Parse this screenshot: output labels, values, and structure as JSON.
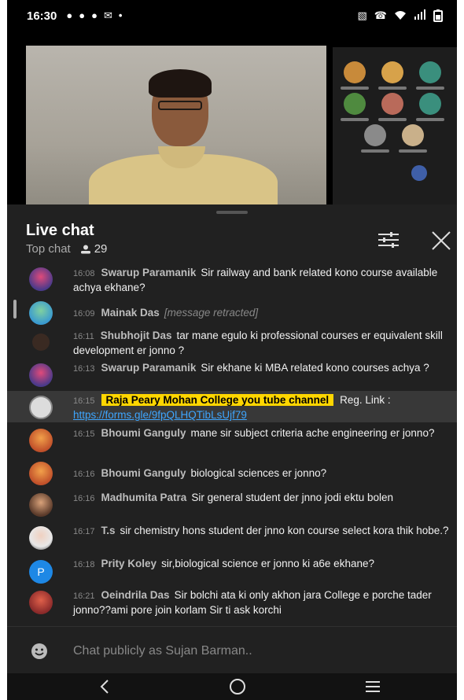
{
  "status_bar": {
    "time": "16:30",
    "left_icons": [
      "whatsapp-icon",
      "whatsapp-icon",
      "jio-icon",
      "gmail-icon",
      "dot-icon"
    ],
    "right_icons": [
      "vibrate-icon",
      "call-icon",
      "wifi-icon",
      "signal-icon",
      "battery-icon"
    ]
  },
  "chat": {
    "title": "Live chat",
    "mode": "Top chat",
    "viewer_count": "29",
    "input_placeholder": "Chat publicly as Sujan Barman..",
    "messages": [
      {
        "time": "16:08",
        "author": "Swarup Paramanik",
        "text": "Sir railway and bank related kono course available achya ekhane?"
      },
      {
        "time": "16:09",
        "author": "Mainak Das",
        "text": "[message retracted]"
      },
      {
        "time": "16:11",
        "author": "Shubhojit Das",
        "text": "tar mane egulo ki professional courses er equivalent skill development er jonno ?"
      },
      {
        "time": "16:13",
        "author": "Swarup Paramanik",
        "text": "Sir ekhane ki MBA related kono courses achya ?"
      },
      {
        "time": "16:15",
        "author": "Raja Peary Mohan College you tube channel",
        "text": "Reg. Link :",
        "link": "https://forms.gle/9fpQLHQTibLsUjf79"
      },
      {
        "time": "16:15",
        "author": "Bhoumi Ganguly",
        "text": "mane sir subject criteria ache engineering er jonno?"
      },
      {
        "time": "16:16",
        "author": "Bhoumi Ganguly",
        "text": "biological sciences er jonno?"
      },
      {
        "time": "16:16",
        "author": "Madhumita Patra",
        "text": "Sir general student der jnno jodi ektu bolen"
      },
      {
        "time": "16:17",
        "author": "T.s",
        "text": "sir chemistry hons student der jnno kon course select kora thik hobe.?"
      },
      {
        "time": "16:18",
        "author": "Prity Koley",
        "text": "sir,biological science er jonno ki a6e ekhane?",
        "avatar_letter": "P"
      },
      {
        "time": "16:21",
        "author": "Oeindrila Das",
        "text": "Sir bolchi ata ki only akhon jara College e porche tader jonno??ami pore join korlam Sir ti ask korchi"
      }
    ]
  },
  "colors": {
    "owner_highlight": "#ffd600",
    "link": "#3ea6ff",
    "accent_red": "#c4302b"
  }
}
